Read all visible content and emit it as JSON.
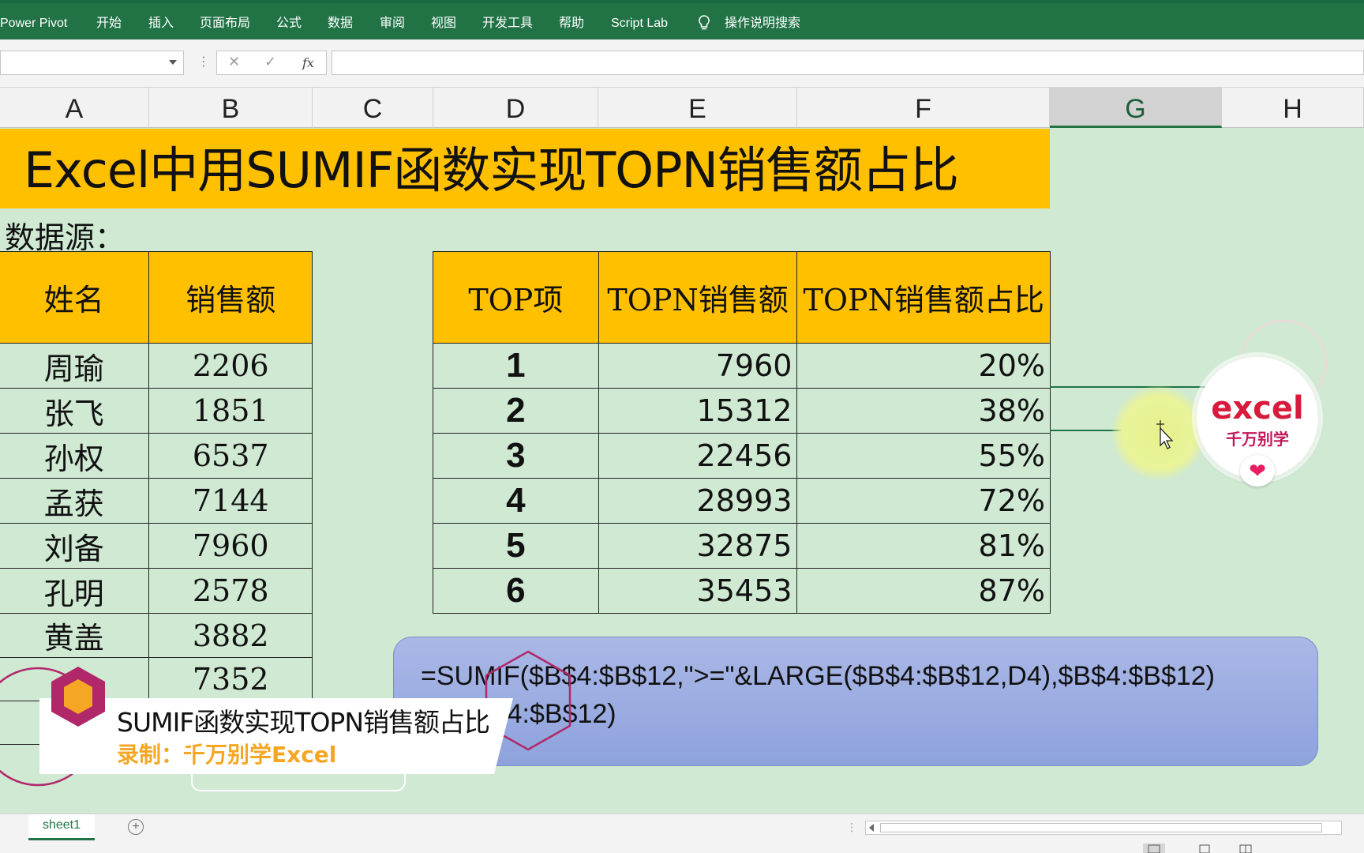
{
  "ribbon": {
    "items": [
      "Power Pivot",
      "开始",
      "插入",
      "页面布局",
      "公式",
      "数据",
      "审阅",
      "视图",
      "开发工具",
      "帮助",
      "Script Lab",
      "操作说明搜索"
    ]
  },
  "formula_bar": {
    "cancel": "✕",
    "enter": "✓",
    "fx": "fx",
    "name_box": "",
    "content": ""
  },
  "columns": [
    "A",
    "B",
    "C",
    "D",
    "E",
    "F",
    "G",
    "H"
  ],
  "banner_title": "Excel中用SUMIF函数实现TOPN销售额占比",
  "source_label": "数据源：",
  "source_table": {
    "headers": [
      "姓名",
      "销售额"
    ],
    "rows": [
      [
        "周瑜",
        "2206"
      ],
      [
        "张飞",
        "1851"
      ],
      [
        "孙权",
        "6537"
      ],
      [
        "孟获",
        "7144"
      ],
      [
        "刘备",
        "7960"
      ],
      [
        "孔明",
        "2578"
      ],
      [
        "黄盖",
        "3882"
      ],
      [
        "",
        "7352"
      ],
      [
        "",
        ""
      ]
    ]
  },
  "top_table": {
    "headers": [
      "TOP项",
      "TOPN销售额",
      "TOPN销售额占比"
    ],
    "rows": [
      [
        "1",
        "7960",
        "20%"
      ],
      [
        "2",
        "15312",
        "38%"
      ],
      [
        "3",
        "22456",
        "55%"
      ],
      [
        "4",
        "28993",
        "72%"
      ],
      [
        "5",
        "32875",
        "81%"
      ],
      [
        "6",
        "35453",
        "87%"
      ]
    ]
  },
  "formula_callout": {
    "line1": "=SUMIF($B$4:$B$12,\">=\"&LARGE($B$4:$B$12,D4),$B$4:$B$12)",
    "line2": "IM($B$4:$B$12)"
  },
  "logo": {
    "line1": "excel",
    "line2": "千万别学",
    "heart": "❤"
  },
  "caption": {
    "title": "SUMIF函数实现TOPN销售额占比",
    "subtitle": "录制：千万别学Excel"
  },
  "sheet_tabs": [
    "sheet1"
  ],
  "add_sheet": "+",
  "colors": {
    "ribbon": "#217346",
    "banner": "#ffc000",
    "sheet_bg": "#cfe9d3",
    "callout": "#9aacE0"
  }
}
